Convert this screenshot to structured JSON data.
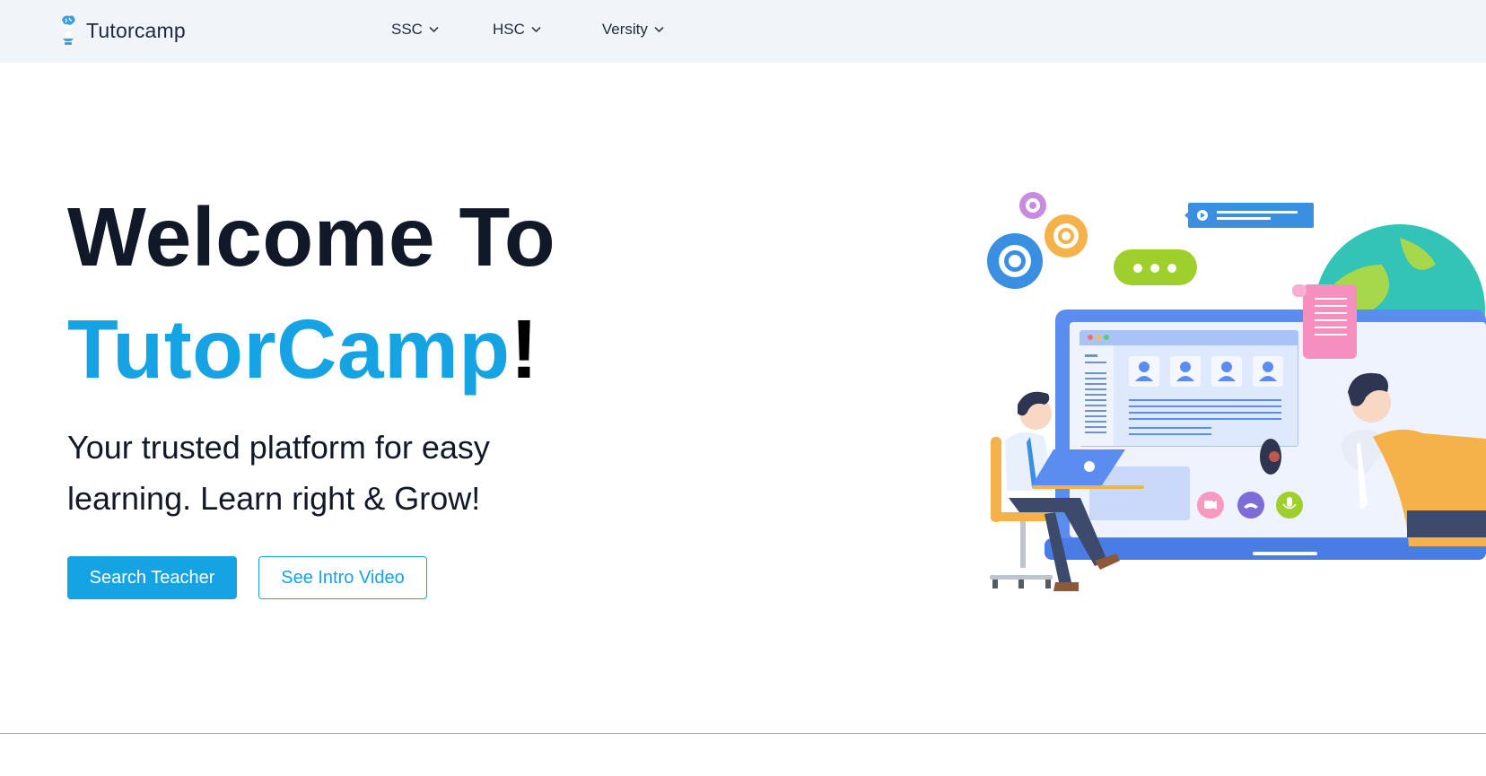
{
  "header": {
    "brand_name": "Tutorcamp",
    "nav": [
      {
        "label": "SSC"
      },
      {
        "label": "HSC"
      },
      {
        "label": "Versity"
      }
    ]
  },
  "hero": {
    "title_line1": "Welcome To",
    "title_brand": "TutorCamp",
    "title_exclaim": "!",
    "subtitle": "Your trusted platform for easy learning. Learn right & Grow!",
    "primary_button": "Search Teacher",
    "secondary_button": "See Intro Video"
  },
  "colors": {
    "accent": "#15a3e4",
    "heading": "#111827",
    "header_bg": "#f1f5f9"
  },
  "icons": {
    "logo": "lightbulb-brain-icon",
    "dropdown": "chevron-down-icon"
  }
}
